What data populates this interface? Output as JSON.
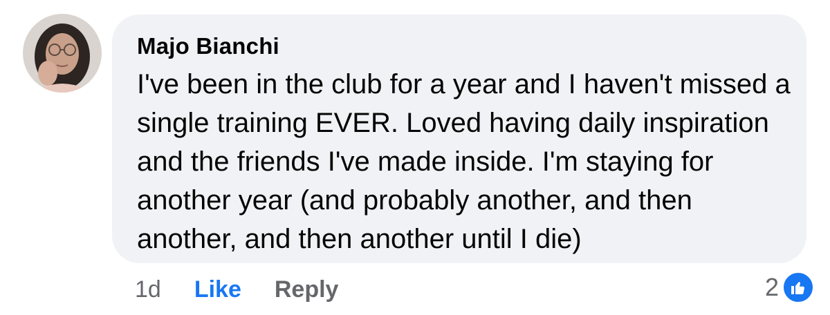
{
  "comment": {
    "author": "Majo Bianchi",
    "text": "I've been in the club for a year and I haven't missed a single training EVER. Loved having daily inspiration and the friends I've made inside. I'm staying for another year (and probably another, and then another, and then another until I die)",
    "avatar_icon": "user-avatar",
    "bubble_color": "#f0f2f5"
  },
  "actions": {
    "time": "1d",
    "like_label": "Like",
    "reply_label": "Reply",
    "like_color": "#1877f2",
    "reply_color": "#65676b"
  },
  "reactions": {
    "count": "2",
    "icon": "thumbs-up-icon",
    "badge_color": "#1877f2"
  }
}
